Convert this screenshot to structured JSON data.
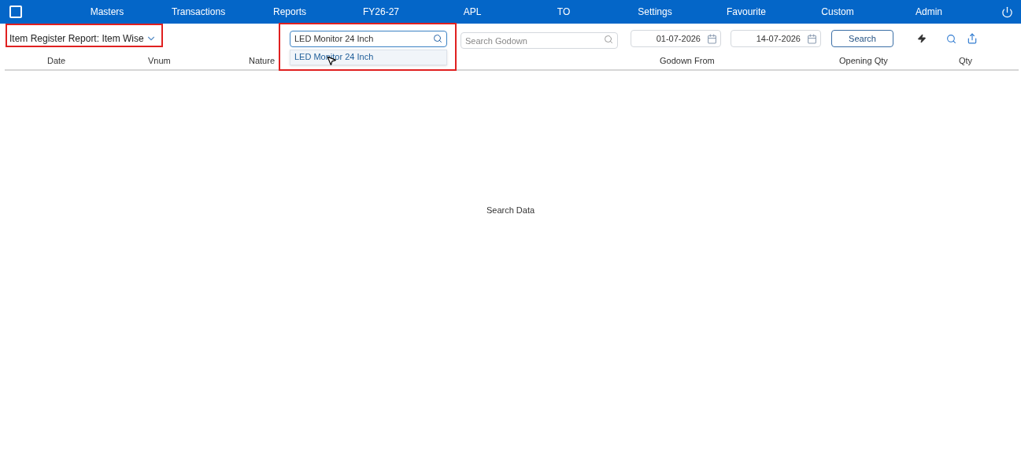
{
  "nav": {
    "items": [
      "Masters",
      "Transactions",
      "Reports",
      "FY26-27",
      "APL",
      "TO",
      "Settings",
      "Favourite",
      "Custom",
      "Admin"
    ]
  },
  "report_title": "Item Register Report: Item Wise",
  "item_search": {
    "value": "LED Monitor 24 Inch",
    "suggestions": [
      "LED Monitor 24 Inch"
    ]
  },
  "godown_search": {
    "placeholder": "Search Godown"
  },
  "date_from": "01-07-2026",
  "date_to": "14-07-2026",
  "search_button": "Search",
  "table": {
    "columns": [
      "Date",
      "Vnum",
      "Nature",
      "",
      "Godown From",
      "Opening Qty",
      "Qty"
    ],
    "empty_message": "Search Data"
  }
}
